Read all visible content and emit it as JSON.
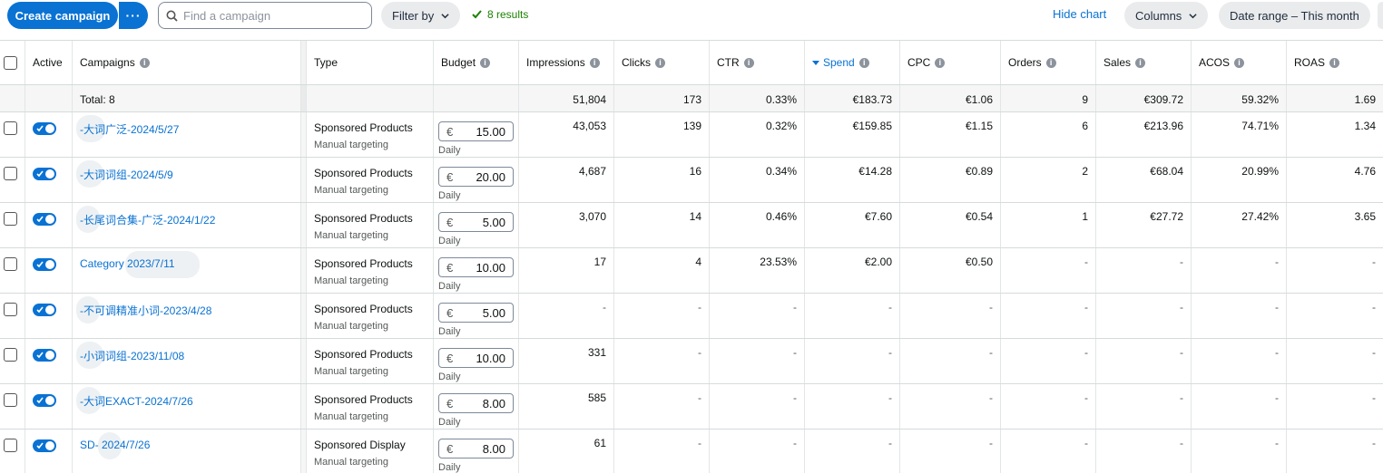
{
  "toolbar": {
    "create_label": "Create campaign",
    "more_label": "···",
    "search_placeholder": "Find a campaign",
    "filter_label": "Filter by",
    "results_label": "8 results",
    "hide_chart_label": "Hide chart",
    "columns_label": "Columns",
    "date_range_label": "Date range – This month"
  },
  "columns": {
    "active": "Active",
    "campaigns": "Campaigns",
    "type": "Type",
    "budget": "Budget",
    "impressions": "Impressions",
    "clicks": "Clicks",
    "ctr": "CTR",
    "spend": "Spend",
    "cpc": "CPC",
    "orders": "Orders",
    "sales": "Sales",
    "acos": "ACOS",
    "roas": "ROAS"
  },
  "total": {
    "label": "Total: 8",
    "impressions": "51,804",
    "clicks": "173",
    "ctr": "0.33%",
    "spend": "€183.73",
    "cpc": "€1.06",
    "orders": "9",
    "sales": "€309.72",
    "acos": "59.32%",
    "roas": "1.69"
  },
  "rows": [
    {
      "name": "-大词广泛-2024/5/27",
      "type": "Sponsored Products",
      "targeting": "Manual targeting",
      "currency": "€",
      "budget": "15.00",
      "budget_period": "Daily",
      "impressions": "43,053",
      "clicks": "139",
      "ctr": "0.32%",
      "spend": "€159.85",
      "cpc": "€1.15",
      "orders": "6",
      "sales": "€213.96",
      "acos": "74.71%",
      "roas": "1.34"
    },
    {
      "name": "-大词词组-2024/5/9",
      "type": "Sponsored Products",
      "targeting": "Manual targeting",
      "currency": "€",
      "budget": "20.00",
      "budget_period": "Daily",
      "impressions": "4,687",
      "clicks": "16",
      "ctr": "0.34%",
      "spend": "€14.28",
      "cpc": "€0.89",
      "orders": "2",
      "sales": "€68.04",
      "acos": "20.99%",
      "roas": "4.76"
    },
    {
      "name": "-长尾词合集-广泛-2024/1/22",
      "type": "Sponsored Products",
      "targeting": "Manual targeting",
      "currency": "€",
      "budget": "5.00",
      "budget_period": "Daily",
      "impressions": "3,070",
      "clicks": "14",
      "ctr": "0.46%",
      "spend": "€7.60",
      "cpc": "€0.54",
      "orders": "1",
      "sales": "€27.72",
      "acos": "27.42%",
      "roas": "3.65"
    },
    {
      "name": "Category                2023/7/11",
      "type": "Sponsored Products",
      "targeting": "Manual targeting",
      "currency": "€",
      "budget": "10.00",
      "budget_period": "Daily",
      "impressions": "17",
      "clicks": "4",
      "ctr": "23.53%",
      "spend": "€2.00",
      "cpc": "€0.50",
      "orders": "-",
      "sales": "-",
      "acos": "-",
      "roas": "-"
    },
    {
      "name": "-不可调精准小词-2023/4/28",
      "type": "Sponsored Products",
      "targeting": "Manual targeting",
      "currency": "€",
      "budget": "5.00",
      "budget_period": "Daily",
      "impressions": "-",
      "clicks": "-",
      "ctr": "-",
      "spend": "-",
      "cpc": "-",
      "orders": "-",
      "sales": "-",
      "acos": "-",
      "roas": "-"
    },
    {
      "name": "-小词词组-2023/11/08",
      "type": "Sponsored Products",
      "targeting": "Manual targeting",
      "currency": "€",
      "budget": "10.00",
      "budget_period": "Daily",
      "impressions": "331",
      "clicks": "-",
      "ctr": "-",
      "spend": "-",
      "cpc": "-",
      "orders": "-",
      "sales": "-",
      "acos": "-",
      "roas": "-"
    },
    {
      "name": "-大词EXACT-2024/7/26",
      "type": "Sponsored Products",
      "targeting": "Manual targeting",
      "currency": "€",
      "budget": "8.00",
      "budget_period": "Daily",
      "impressions": "585",
      "clicks": "-",
      "ctr": "-",
      "spend": "-",
      "cpc": "-",
      "orders": "-",
      "sales": "-",
      "acos": "-",
      "roas": "-"
    },
    {
      "name": "SD-        2024/7/26",
      "type": "Sponsored Display",
      "targeting": "Manual targeting",
      "currency": "€",
      "budget": "8.00",
      "budget_period": "Daily",
      "impressions": "61",
      "clicks": "-",
      "ctr": "-",
      "spend": "-",
      "cpc": "-",
      "orders": "-",
      "sales": "-",
      "acos": "-",
      "roas": "-"
    }
  ]
}
